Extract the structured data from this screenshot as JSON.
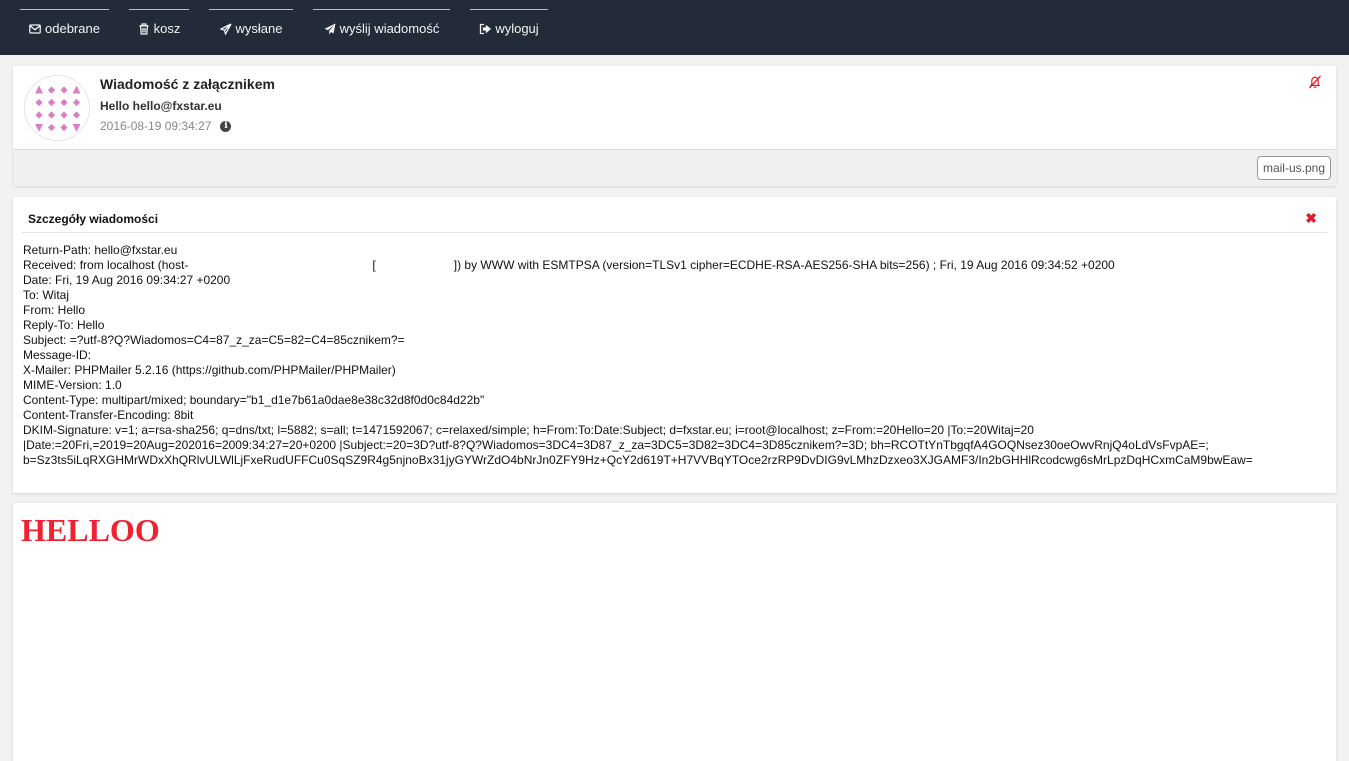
{
  "nav": {
    "items": [
      {
        "label": "odebrane",
        "icon": "envelope-icon"
      },
      {
        "label": "kosz",
        "icon": "trash-icon"
      },
      {
        "label": "wysłane",
        "icon": "paper-plane-outline-icon"
      },
      {
        "label": "wyślij wiadomość",
        "icon": "paper-plane-icon"
      },
      {
        "label": "wyloguj",
        "icon": "sign-out-icon"
      }
    ]
  },
  "message": {
    "subject": "Wiadomość z załącznikem",
    "from": "Hello hello@fxstar.eu",
    "date": "2016-08-19 09:34:27",
    "avatar_color": "#d97fc6",
    "bell_color": "#dd1f2d"
  },
  "attachment": {
    "filename": "mail-us.png"
  },
  "details": {
    "title": "Szczegóły wiadomości",
    "close_symbol": "✖",
    "headers": {
      "return_path": "Return-Path: hello@fxstar.eu",
      "received_a": "Received: from localhost (host-",
      "received_b": "[",
      "received_c": "]) by WWW with ESMTPSA (version=TLSv1 cipher=ECDHE-RSA-AES256-SHA bits=256) ; Fri, 19 Aug 2016 09:34:52 +0200",
      "date": "Date: Fri, 19 Aug 2016 09:34:27 +0200",
      "to": "To: Witaj",
      "from": "From: Hello",
      "reply_to": "Reply-To: Hello",
      "subject": "Subject: =?utf-8?Q?Wiadomos=C4=87_z_za=C5=82=C4=85cznikem?=",
      "message_id": "Message-ID:",
      "x_mailer": "X-Mailer: PHPMailer 5.2.16 (https://github.com/PHPMailer/PHPMailer)",
      "mime_version": "MIME-Version: 1.0",
      "content_type": "Content-Type: multipart/mixed; boundary=\"b1_d1e7b61a0dae8e38c32d8f0d0c84d22b\"",
      "cte": "Content-Transfer-Encoding: 8bit",
      "dkim_1": "DKIM-Signature: v=1; a=rsa-sha256; q=dns/txt; l=5882; s=all; t=1471592067; c=relaxed/simple; h=From:To:Date:Subject; d=fxstar.eu; i=root@localhost; z=From:=20Hello=20 |To:=20Witaj=20",
      "dkim_2": "|Date:=20Fri,=2019=20Aug=202016=2009:34:27=20+0200 |Subject:=20=3D?utf-8?Q?Wiadomos=3DC4=3D87_z_za=3DC5=3D82=3DC4=3D85cznikem?=3D; bh=RCOTtYnTbgqfA4GOQNsez30oeOwvRnjQ4oLdVsFvpAE=;",
      "dkim_3": "b=Sz3ts5iLqRXGHMrWDxXhQRlvULWlLjFxeRudUFFCu0SqSZ9R4g5njnoBx31jyGYWrZdO4bNrJn0ZFY9Hz+QcY2d619T+H7VVBqYTOce2rzRP9DvDIG9vLMhzDzxeo3XJGAMF3/In2bGHHlRcodcwg6sMrLpzDqHCxmCaM9bwEaw="
    }
  },
  "body": {
    "text": "HELLOO",
    "color": "#ee2233"
  }
}
